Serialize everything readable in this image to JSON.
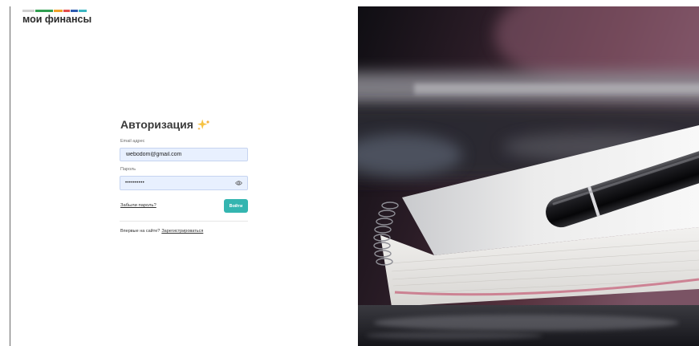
{
  "brand": {
    "name": "мои финансы",
    "stripe_colors": [
      "#cfcfcf",
      "#2f9e50",
      "#f2a12a",
      "#e34b4b",
      "#2d5bb0",
      "#3ab6c2"
    ]
  },
  "login": {
    "title": "Авторизация",
    "title_icon": "sparkles-icon",
    "email": {
      "label": "Email адрес",
      "value": "webodom@gmail.com"
    },
    "password": {
      "label": "Пароль",
      "value": "••••••••••",
      "toggle_icon": "eye-icon"
    },
    "forgot_link": "Забыли пароль?",
    "submit_label": "Войти",
    "signup_prompt": "Впервые на сайте?",
    "signup_link": "Зарегистрироваться"
  },
  "colors": {
    "accent": "#34b5b0",
    "input_bg": "#e8f0fe",
    "text": "#3a3a3a"
  }
}
